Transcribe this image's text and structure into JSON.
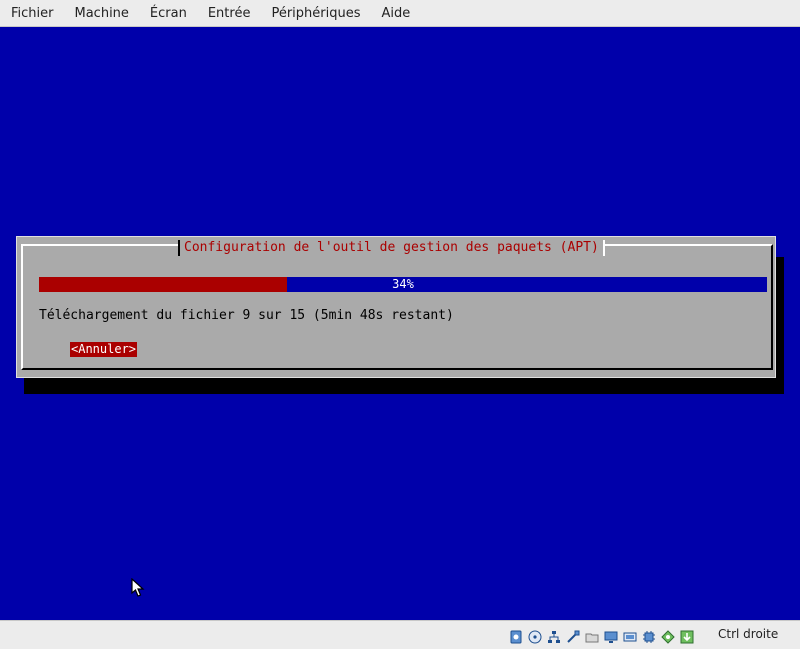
{
  "menubar": {
    "items": [
      "Fichier",
      "Machine",
      "Écran",
      "Entrée",
      "Périphériques",
      "Aide"
    ]
  },
  "dialog": {
    "title": "Configuration de l'outil de gestion des paquets (APT)",
    "progress": {
      "percent": 34,
      "label": "34%"
    },
    "status_text": "Téléchargement du fichier 9 sur 15 (5min 48s restant)",
    "cancel_label": "<Annuler>"
  },
  "statusbar": {
    "icons": [
      "hard-disk-icon",
      "optical-disk-icon",
      "network-icon",
      "usb-icon",
      "shared-folder-icon",
      "display-icon",
      "video-capture-icon",
      "cpu-icon",
      "mouse-integration-icon",
      "keyboard-capture-icon"
    ],
    "host_key_label": "Ctrl droite"
  },
  "colors": {
    "screen": "#0000aa",
    "dialog": "#aaaaaa",
    "accent": "#aa0000"
  }
}
